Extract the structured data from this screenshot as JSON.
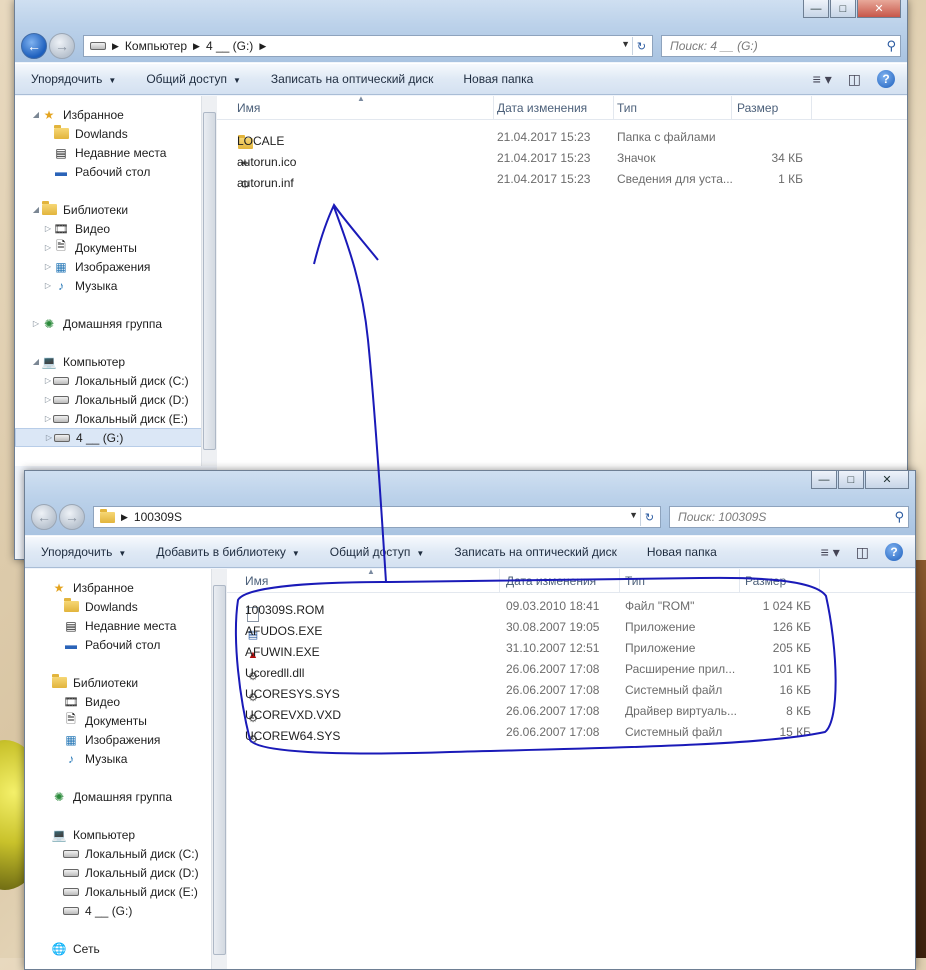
{
  "window1": {
    "address": {
      "path": [
        "Компьютер",
        "4 __ (G:)"
      ]
    },
    "search_placeholder": "Поиск: 4 __ (G:)",
    "toolbar": [
      "Упорядочить",
      "Общий доступ",
      "Записать на оптический диск",
      "Новая папка"
    ],
    "nav": {
      "favorites": {
        "label": "Избранное",
        "items": [
          "Dowlands",
          "Недавние места",
          "Рабочий стол"
        ]
      },
      "libraries": {
        "label": "Библиотеки",
        "items": [
          "Видео",
          "Документы",
          "Изображения",
          "Музыка"
        ]
      },
      "homegroup": "Домашняя группа",
      "computer": {
        "label": "Компьютер",
        "items": [
          "Локальный диск (C:)",
          "Локальный диск (D:)",
          "Локальный диск (E:)",
          "4 __ (G:)"
        ]
      }
    },
    "columns": {
      "name": "Имя",
      "date": "Дата изменения",
      "type": "Тип",
      "size": "Размер"
    },
    "files": [
      {
        "name": "LOCALE",
        "date": "21.04.2017 15:23",
        "type": "Папка с файлами",
        "size": "",
        "icon": "folder-icon"
      },
      {
        "name": "autorun.ico",
        "date": "21.04.2017 15:23",
        "type": "Значок",
        "size": "34 КБ",
        "icon": "pen-icon"
      },
      {
        "name": "autorun.inf",
        "date": "21.04.2017 15:23",
        "type": "Сведения для уста...",
        "size": "1 КБ",
        "icon": "settings-file-icon"
      }
    ]
  },
  "window2": {
    "address": {
      "path": [
        "100309S"
      ]
    },
    "search_placeholder": "Поиск: 100309S",
    "toolbar": [
      "Упорядочить",
      "Добавить в библиотеку",
      "Общий доступ",
      "Записать на оптический диск",
      "Новая папка"
    ],
    "nav": {
      "favorites": {
        "label": "Избранное",
        "items": [
          "Dowlands",
          "Недавние места",
          "Рабочий стол"
        ]
      },
      "libraries": {
        "label": "Библиотеки",
        "items": [
          "Видео",
          "Документы",
          "Изображения",
          "Музыка"
        ]
      },
      "homegroup": "Домашняя группа",
      "computer": {
        "label": "Компьютер",
        "items": [
          "Локальный диск (C:)",
          "Локальный диск (D:)",
          "Локальный диск (E:)",
          "4 __ (G:)"
        ]
      },
      "network": "Сеть"
    },
    "columns": {
      "name": "Имя",
      "date": "Дата изменения",
      "type": "Тип",
      "size": "Размер"
    },
    "files": [
      {
        "name": "100309S.ROM",
        "date": "09.03.2010 18:41",
        "type": "Файл \"ROM\"",
        "size": "1 024 КБ",
        "icon": "file-icon"
      },
      {
        "name": "AFUDOS.EXE",
        "date": "30.08.2007 19:05",
        "type": "Приложение",
        "size": "126 КБ",
        "icon": "app-icon"
      },
      {
        "name": "AFUWIN.EXE",
        "date": "31.10.2007 12:51",
        "type": "Приложение",
        "size": "205 КБ",
        "icon": "afu-icon"
      },
      {
        "name": "Ucoredll.dll",
        "date": "26.06.2007 17:08",
        "type": "Расширение прил...",
        "size": "101 КБ",
        "icon": "dll-icon"
      },
      {
        "name": "UCORESYS.SYS",
        "date": "26.06.2007 17:08",
        "type": "Системный файл",
        "size": "16 КБ",
        "icon": "sys-file-icon"
      },
      {
        "name": "UCOREVXD.VXD",
        "date": "26.06.2007 17:08",
        "type": "Драйвер виртуаль...",
        "size": "8 КБ",
        "icon": "sys-file-icon"
      },
      {
        "name": "UCOREW64.SYS",
        "date": "26.06.2007 17:08",
        "type": "Системный файл",
        "size": "15 КБ",
        "icon": "sys-file-icon"
      }
    ]
  },
  "colors": {
    "annotation": "#1a1ab8",
    "selection": "#dbe7f6"
  }
}
